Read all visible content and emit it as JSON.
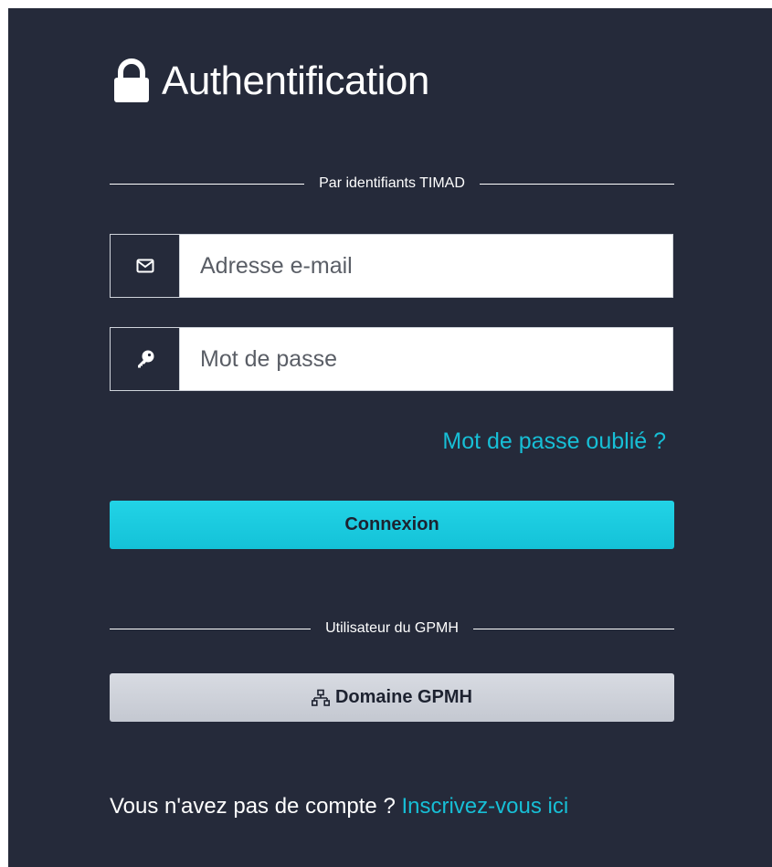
{
  "header": {
    "title": "Authentification",
    "icon": "lock-icon"
  },
  "sections": {
    "credentials_label": "Par identifiants TIMAD",
    "domain_label": "Utilisateur du GPMH"
  },
  "form": {
    "email": {
      "icon": "envelope-icon",
      "placeholder": "Adresse e-mail",
      "value": ""
    },
    "password": {
      "icon": "key-icon",
      "placeholder": "Mot de passe",
      "value": ""
    },
    "forgot_link": "Mot de passe oublié ?",
    "submit_label": "Connexion"
  },
  "domain_button": {
    "icon": "network-icon",
    "label": "Domaine GPMH"
  },
  "signup": {
    "prompt": "Vous n'avez pas de compte ?",
    "link": "Inscrivez-vous ici"
  },
  "colors": {
    "panel_bg": "#252a3a",
    "accent": "#17bfd6",
    "primary_button": "#1ccbe0",
    "secondary_button": "#cfd2da"
  }
}
